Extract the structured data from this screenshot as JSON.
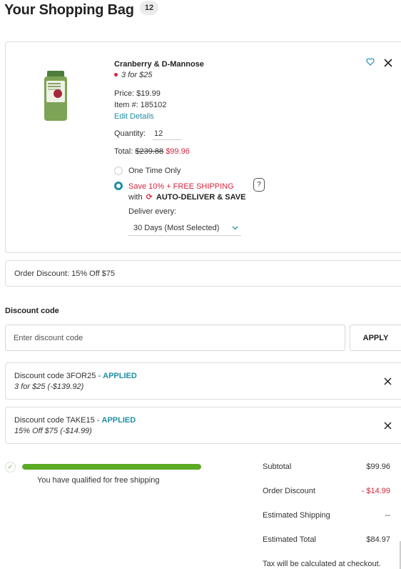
{
  "header": {
    "title": "Your Shopping Bag",
    "count": "12"
  },
  "product": {
    "name": "Cranberry & D-Mannose",
    "promo": "3 for $25",
    "price": "Price: $19.99",
    "item_number": "Item #: 185102",
    "edit_link": "Edit Details",
    "quantity_label": "Quantity:",
    "quantity_value": "12",
    "total_label": "Total:",
    "total_original": "$239.88",
    "total_sale": "$99.96",
    "option_one_time": "One Time Only",
    "option_autodeliver_line1": "Save 10% + FREE SHIPPING",
    "option_autodeliver_with": "with",
    "option_autodeliver_name": "AUTO-DELIVER & SAVE",
    "help_icon_text": "?",
    "deliver_label": "Deliver every:",
    "deliver_value": "30 Days (Most Selected)",
    "selected_option": "autodeliver"
  },
  "order_discount": {
    "text": "Order Discount: 15% Off $75"
  },
  "discount_code": {
    "heading": "Discount code",
    "placeholder": "Enter discount code",
    "apply_label": "APPLY",
    "codes": [
      {
        "title": "Discount code 3FOR25 - ",
        "status": "APPLIED",
        "detail": "3 for $25 (-$139.92)"
      },
      {
        "title": "Discount code TAKE15 - ",
        "status": "APPLIED",
        "detail": "15% Off $75 (-$14.99)"
      }
    ]
  },
  "shipping": {
    "message": "You have qualified for free shipping",
    "progress_fraction": 1.0
  },
  "summary": {
    "rows": [
      {
        "label": "Subtotal",
        "value": "$99.96"
      },
      {
        "label": "Order Discount",
        "value": "- $14.99"
      },
      {
        "label": "Estimated Shipping",
        "value": "--"
      },
      {
        "label": "Estimated Total",
        "value": "$84.97"
      }
    ],
    "tax_note": "Tax will be calculated at checkout."
  },
  "colors": {
    "accent": "#1f8fa5",
    "sale": "#d2263e",
    "progress": "#5aaa24"
  },
  "icons": [
    "heart-icon",
    "close-icon",
    "refresh-icon",
    "help-icon",
    "chevron-down-icon",
    "checkmark-icon"
  ]
}
